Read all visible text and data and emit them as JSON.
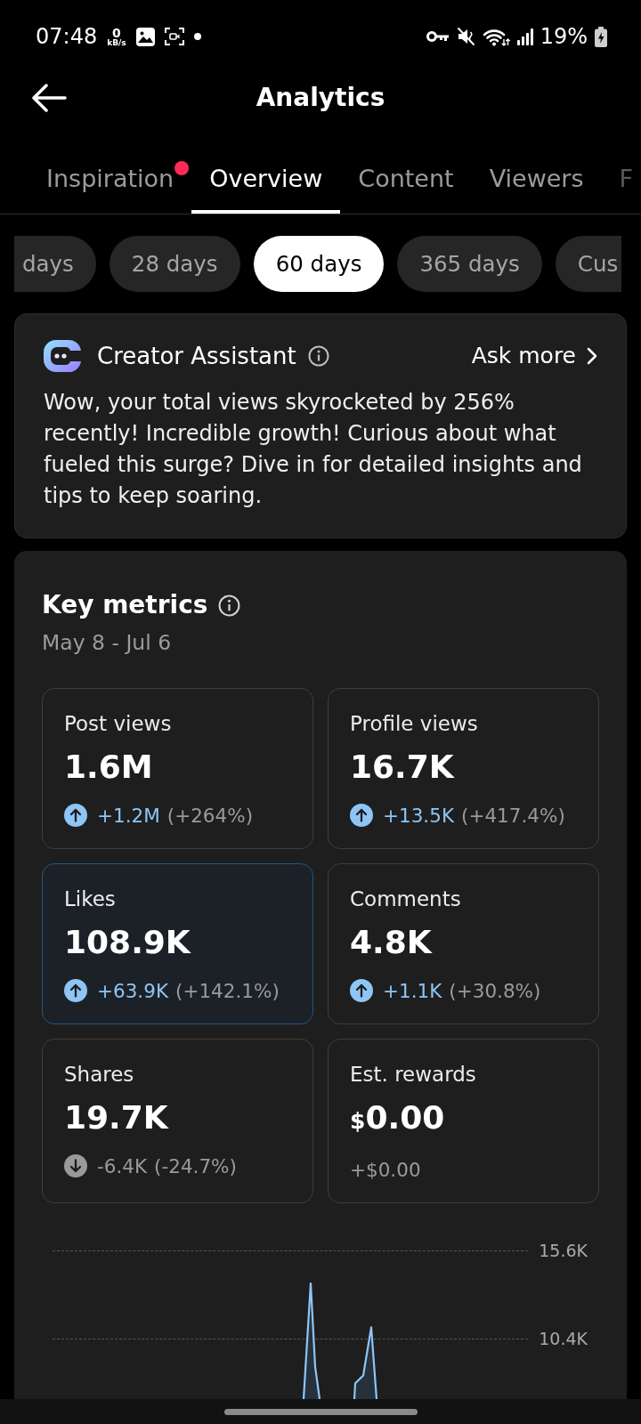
{
  "status_bar": {
    "time": "07:48",
    "net_speed": {
      "value": "0",
      "unit": "kB/s"
    },
    "battery": "19%"
  },
  "header": {
    "title": "Analytics"
  },
  "tabs": [
    {
      "label": "Inspiration",
      "selected": false,
      "badge": true
    },
    {
      "label": "Overview",
      "selected": true,
      "badge": false
    },
    {
      "label": "Content",
      "selected": false,
      "badge": false
    },
    {
      "label": "Viewers",
      "selected": false,
      "badge": false
    },
    {
      "label": "F",
      "selected": false,
      "badge": false
    }
  ],
  "date_ranges": [
    {
      "label": "days",
      "selected": false
    },
    {
      "label": "28 days",
      "selected": false
    },
    {
      "label": "60 days",
      "selected": true
    },
    {
      "label": "365 days",
      "selected": false
    },
    {
      "label": "Cus",
      "selected": false
    }
  ],
  "assistant": {
    "title": "Creator Assistant",
    "action": "Ask more",
    "message": "Wow, your total views skyrocketed by 256% recently! Incredible growth! Curious about what fueled this surge? Dive in for detailed insights and tips to keep soaring."
  },
  "key_metrics": {
    "title": "Key metrics",
    "date_range": "May 8 - Jul 6",
    "metrics": [
      {
        "label": "Post views",
        "value": "1.6M",
        "kind": "up",
        "change": "+1.2M",
        "percent": "(+264%)",
        "selected": false
      },
      {
        "label": "Profile views",
        "value": "16.7K",
        "kind": "up",
        "change": "+13.5K",
        "percent": "(+417.4%)",
        "selected": false
      },
      {
        "label": "Likes",
        "value": "108.9K",
        "kind": "up",
        "change": "+63.9K",
        "percent": "(+142.1%)",
        "selected": true
      },
      {
        "label": "Comments",
        "value": "4.8K",
        "kind": "up",
        "change": "+1.1K",
        "percent": "(+30.8%)",
        "selected": false
      },
      {
        "label": "Shares",
        "value": "19.7K",
        "kind": "down",
        "change": "-6.4K",
        "percent": "(-24.7%)",
        "selected": false
      },
      {
        "label": "Est. rewards",
        "currency": "$",
        "value": "0.00",
        "kind": "flat",
        "change": "+$0.00",
        "selected": false
      }
    ],
    "chart": {
      "gridlines": [
        {
          "label": "15.6K"
        },
        {
          "label": "10.4K"
        }
      ]
    }
  }
}
